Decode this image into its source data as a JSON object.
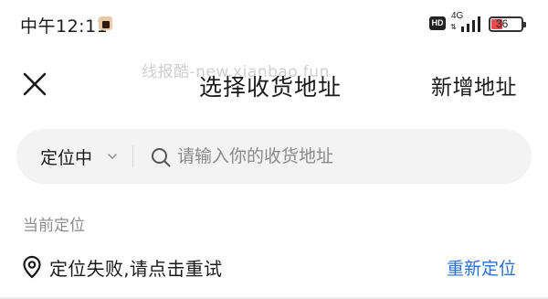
{
  "status_bar": {
    "time": "中午12:11",
    "hd": "HD",
    "network": "4G",
    "network_arrows": "⇅",
    "battery": "36",
    "battery_level": 0.36,
    "battery_color": "#e84a4a"
  },
  "watermark": "线报酷-new.xianbao.fun",
  "header": {
    "title": "选择收货地址",
    "add_label": "新增地址"
  },
  "search": {
    "location_label": "定位中",
    "placeholder": "请输入你的收货地址"
  },
  "current_location": {
    "section_label": "当前定位",
    "status_text": "定位失败,请点击重试",
    "relocate_label": "重新定位",
    "accent_color": "#2a6fd6"
  },
  "icons": [
    "close-icon",
    "chevron-down-icon",
    "search-icon",
    "location-pin-icon",
    "signal-icon",
    "battery-icon",
    "hd-icon"
  ]
}
